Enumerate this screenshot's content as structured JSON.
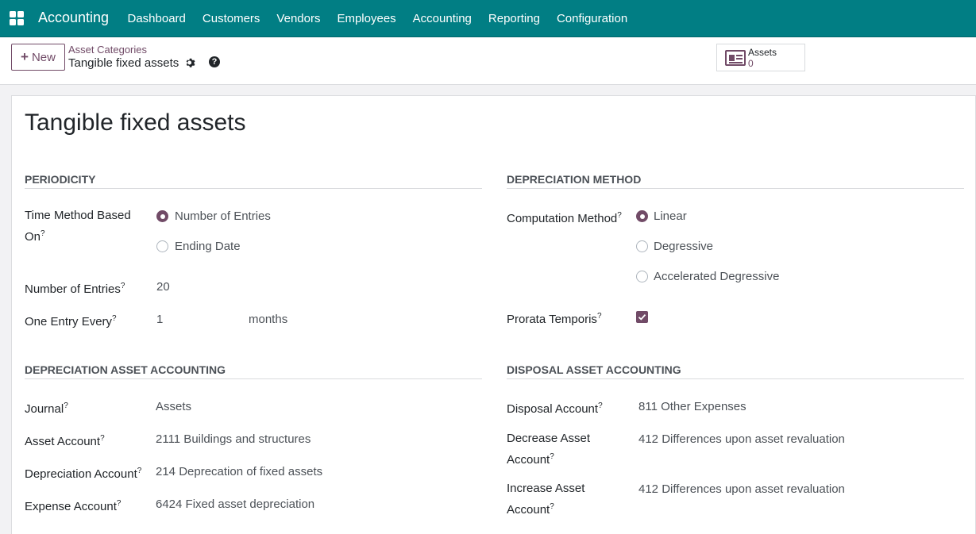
{
  "navbar": {
    "brand": "Accounting",
    "menu": [
      "Dashboard",
      "Customers",
      "Vendors",
      "Employees",
      "Accounting",
      "Reporting",
      "Configuration"
    ]
  },
  "control": {
    "new_label": "New",
    "breadcrumb": "Asset Categories",
    "record_title": "Tangible fixed assets",
    "help_glyph": "?",
    "smart_button": {
      "label": "Assets",
      "count": "0"
    }
  },
  "form": {
    "title": "Tangible fixed assets",
    "periodicity": {
      "heading": "PERIODICITY",
      "time_method_label_1": "Time Method Based",
      "time_method_label_2": "On",
      "time_method_options": [
        "Number of Entries",
        "Ending Date"
      ],
      "time_method_selected": "Number of Entries",
      "number_entries_label": "Number of Entries",
      "number_entries_value": "20",
      "entry_every_label": "One Entry Every",
      "entry_every_value": "1",
      "entry_every_unit": "months"
    },
    "depreciation_method": {
      "heading": "DEPRECIATION METHOD",
      "computation_label": "Computation Method",
      "computation_options": [
        "Linear",
        "Degressive",
        "Accelerated Degressive"
      ],
      "computation_selected": "Linear",
      "prorata_label": "Prorata Temporis",
      "prorata_checked": true
    },
    "depreciation_accounting": {
      "heading": "DEPRECIATION ASSET ACCOUNTING",
      "journal_label": "Journal",
      "journal_value": "Assets",
      "asset_account_label": "Asset Account",
      "asset_account_value": "2111 Buildings and structures",
      "depreciation_account_label": "Depreciation Account",
      "depreciation_account_value": "214 Deprecation of fixed assets",
      "expense_account_label": "Expense Account",
      "expense_account_value": "6424 Fixed asset depreciation"
    },
    "disposal_accounting": {
      "heading": "DISPOSAL ASSET ACCOUNTING",
      "disposal_account_label": "Disposal Account",
      "disposal_account_value": "811 Other Expenses",
      "decrease_label_1": "Decrease Asset",
      "decrease_label_2": "Account",
      "decrease_value": "412 Differences upon asset revaluation",
      "increase_label_1": "Increase Asset",
      "increase_label_2": "Account",
      "increase_value": "412 Differences upon asset revaluation"
    },
    "tooltip_mark": "?"
  },
  "colors": {
    "navbar": "#017e84",
    "accent": "#714b67"
  }
}
